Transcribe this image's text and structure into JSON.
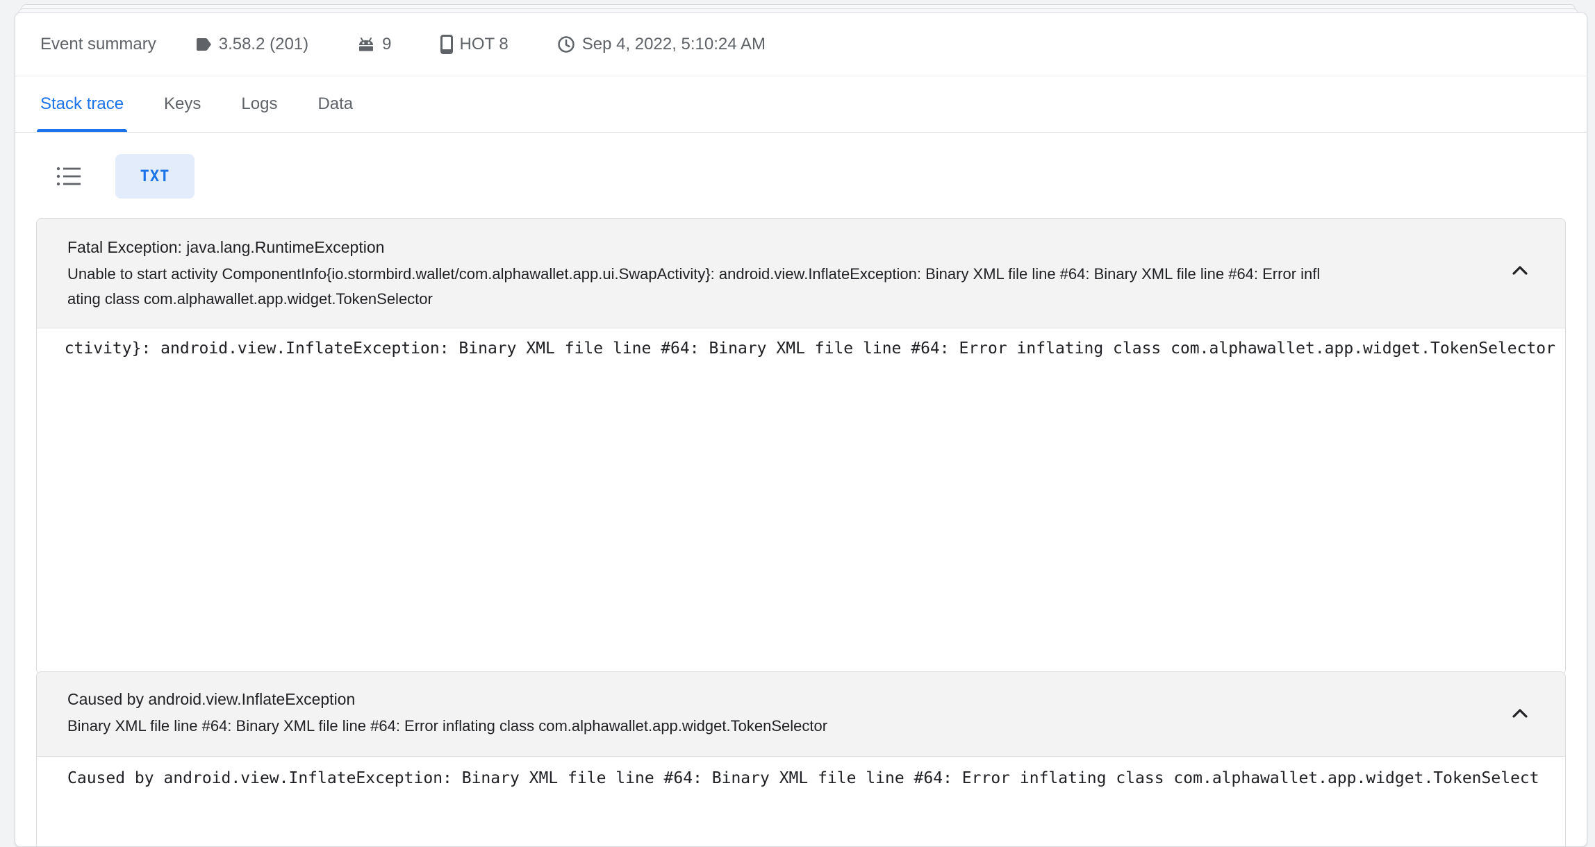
{
  "summary": {
    "title": "Event summary",
    "version": "3.58.2 (201)",
    "android_version": "9",
    "device": "HOT 8",
    "timestamp": "Sep 4, 2022, 5:10:24 AM"
  },
  "tabs": [
    {
      "label": "Stack trace",
      "active": true
    },
    {
      "label": "Keys",
      "active": false
    },
    {
      "label": "Logs",
      "active": false
    },
    {
      "label": "Data",
      "active": false
    }
  ],
  "view_toggle": {
    "list_icon": "list-icon",
    "txt_label": "TXT"
  },
  "exceptions": [
    {
      "title": "Fatal Exception: java.lang.RuntimeException",
      "message_line1": "Unable to start activity ComponentInfo{io.stormbird.wallet/com.alphawallet.app.ui.SwapActivity}: android.view.InflateException: Binary XML file line #64: Binary XML file line #64: Error infl",
      "message_line2": "ating class com.alphawallet.app.widget.TokenSelector",
      "trace": "ctivity}: android.view.InflateException: Binary XML file line #64: Binary XML file line #64: Error inflating class com.alphawallet.app.widget.TokenSelector"
    },
    {
      "title": "Caused by android.view.InflateException",
      "message_line1": "Binary XML file line #64: Binary XML file line #64: Error inflating class com.alphawallet.app.widget.TokenSelector",
      "trace": "Caused by android.view.InflateException: Binary XML file line #64: Binary XML file line #64: Error inflating class com.alphawallet.app.widget.TokenSelect"
    }
  ],
  "colors": {
    "accent": "#1a73e8",
    "header_bg": "#f3f3f3",
    "toggle_bg": "#e3ecfb"
  }
}
